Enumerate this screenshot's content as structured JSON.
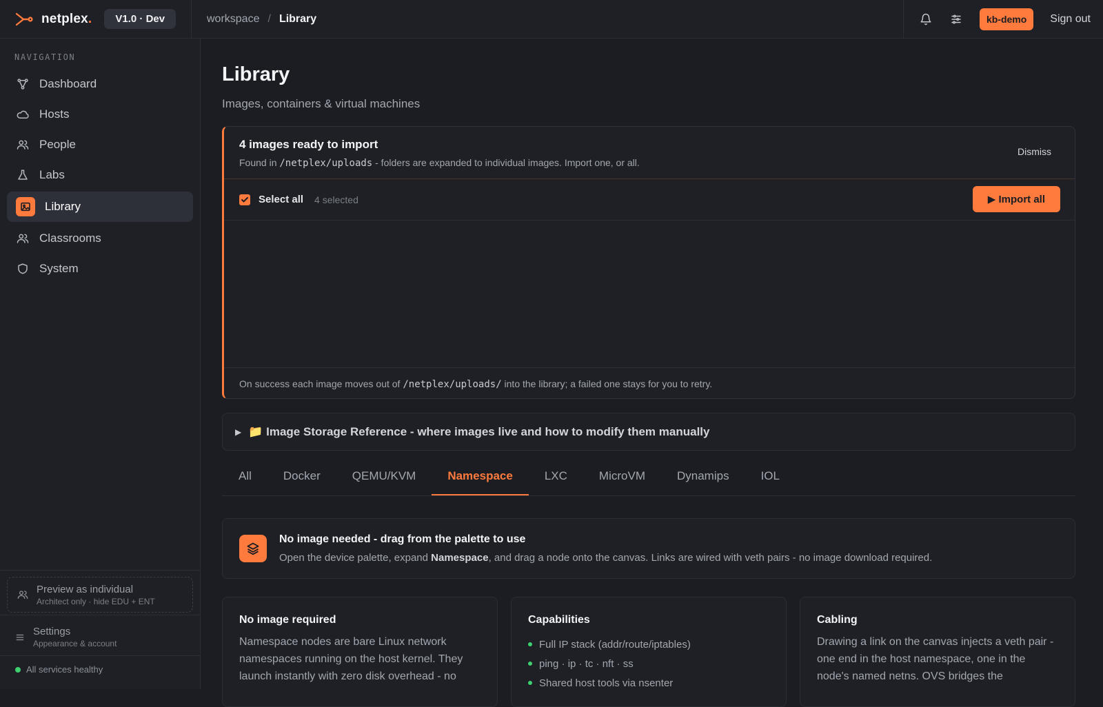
{
  "brand": {
    "name": "netplex",
    "dot": ".",
    "version": "V1.0 · Dev"
  },
  "breadcrumb": {
    "root": "workspace",
    "sep": "/",
    "current": "Library"
  },
  "topbar": {
    "user_badge": "kb-demo",
    "signout_label": "Sign out"
  },
  "sidebar": {
    "heading": "NAVIGATION",
    "items": [
      {
        "label": "Dashboard",
        "icon": "topology-icon"
      },
      {
        "label": "Hosts",
        "icon": "cloud-icon"
      },
      {
        "label": "People",
        "icon": "people-icon"
      },
      {
        "label": "Labs",
        "icon": "flask-icon"
      },
      {
        "label": "Library",
        "icon": "image-icon",
        "active": true
      },
      {
        "label": "Classrooms",
        "icon": "people-icon"
      },
      {
        "label": "System",
        "icon": "shield-icon"
      }
    ],
    "preview": {
      "title": "Preview as individual",
      "subtitle": "Architect only · hide EDU + ENT"
    },
    "settings": {
      "title": "Settings",
      "subtitle": "Appearance & account"
    },
    "health": "All services healthy"
  },
  "page": {
    "title": "Library",
    "subtitle": "Images, containers & virtual machines"
  },
  "import": {
    "title": "4 images ready to import",
    "desc_prefix": "Found in ",
    "desc_path": "/netplex/uploads",
    "desc_suffix": " - folders are expanded to individual images. Import one, or all.",
    "dismiss_label": "Dismiss",
    "select_all_label": "Select all",
    "selected_count": "4 selected",
    "import_all_label": "▶ Import all",
    "foot_prefix": "On success each image moves out of ",
    "foot_path": "/netplex/uploads/",
    "foot_suffix": " into the library; a failed one stays for you to retry."
  },
  "storage_ref": {
    "label": "📁 Image Storage Reference - where images live and how to modify them manually"
  },
  "tabs": [
    "All",
    "Docker",
    "QEMU/KVM",
    "Namespace",
    "LXC",
    "MicroVM",
    "Dynamips",
    "IOL"
  ],
  "active_tab": "Namespace",
  "info": {
    "title": "No image needed - drag from the palette to use",
    "desc_prefix": "Open the device palette, expand ",
    "desc_bold": "Namespace",
    "desc_suffix": ", and drag a node onto the canvas. Links are wired with veth pairs - no image download required."
  },
  "cards": {
    "no_image": {
      "title": "No image required",
      "body": "Namespace nodes are bare Linux network namespaces running on the host kernel. They launch instantly with zero disk overhead - no"
    },
    "capabilities": {
      "title": "Capabilities",
      "items": [
        "Full IP stack (addr/route/iptables)",
        "ping · ip · tc · nft · ss",
        "Shared host tools via nsenter"
      ]
    },
    "cabling": {
      "title": "Cabling",
      "body": "Drawing a link on the canvas injects a veth pair - one end in the host namespace, one in the node's named netns. OVS bridges the"
    }
  },
  "colors": {
    "accent": "#ff7a3d",
    "healthy": "#3ecf6e",
    "background": "#1b1d22",
    "panel": "#1e2025"
  }
}
